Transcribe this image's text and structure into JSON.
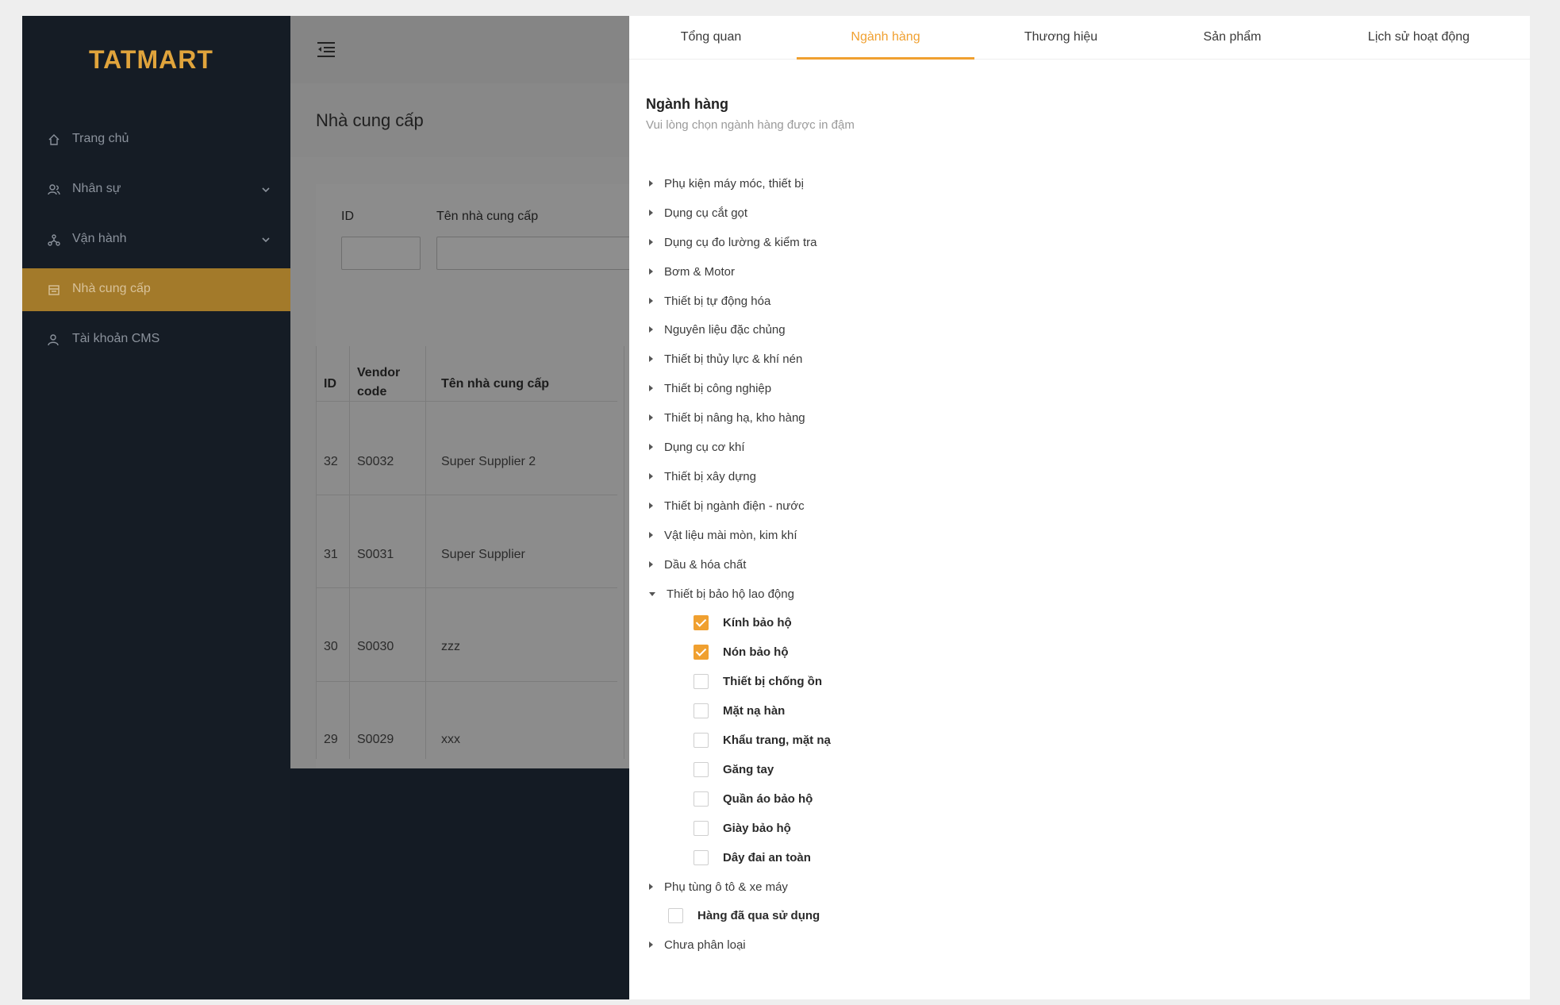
{
  "brand": {
    "logo_text": "TATMART",
    "accent": "#f0a030",
    "sidebar_bg": "#151c25"
  },
  "sidebar": {
    "items": [
      {
        "label": "Trang chủ",
        "icon": "home-icon",
        "expandable": false,
        "active": false
      },
      {
        "label": "Nhân sự",
        "icon": "users-icon",
        "expandable": true,
        "active": false
      },
      {
        "label": "Vận hành",
        "icon": "network-icon",
        "expandable": true,
        "active": false
      },
      {
        "label": "Nhà cung cấp",
        "icon": "calendar-icon",
        "expandable": false,
        "active": true
      },
      {
        "label": "Tài khoản CMS",
        "icon": "user-icon",
        "expandable": false,
        "active": false
      }
    ]
  },
  "main": {
    "title": "Nhà cung cấp",
    "filters": {
      "id_label": "ID",
      "name_label": "Tên nhà cung cấp"
    },
    "table": {
      "headers": [
        "ID",
        "Vendor code",
        "Tên nhà cung cấp"
      ],
      "rows": [
        [
          "32",
          "S0032",
          "Super Supplier 2"
        ],
        [
          "31",
          "S0031",
          "Super Supplier"
        ],
        [
          "30",
          "S0030",
          "zzz"
        ],
        [
          "29",
          "S0029",
          "xxx"
        ]
      ]
    }
  },
  "drawer": {
    "tabs": [
      "Tổng quan",
      "Ngành hàng",
      "Thương hiệu",
      "Sản phẩm",
      "Lịch sử hoạt động"
    ],
    "active_tab": "Ngành hàng",
    "section_title": "Ngành hàng",
    "section_subtitle": "Vui lòng chọn ngành hàng được in đậm",
    "categories": [
      "Phụ kiện máy móc, thiết bị",
      "Dụng cụ cắt gọt",
      "Dụng cụ đo lường & kiểm tra",
      "Bơm & Motor",
      "Thiết bị tự động hóa",
      "Nguyên liệu đặc chủng",
      "Thiết bị thủy lực & khí nén",
      "Thiết bị công nghiệp",
      "Thiết bị nâng hạ, kho hàng",
      "Dụng cụ cơ khí",
      "Thiết bị xây dựng",
      "Thiết bị ngành điện - nước",
      "Vật liệu mài mòn, kim khí",
      "Dầu & hóa chất"
    ],
    "expanded_category": "Thiết bị bảo hộ lao động",
    "subcategories": [
      {
        "label": "Kính bảo hộ",
        "checked": true
      },
      {
        "label": "Nón bảo hộ",
        "checked": true
      },
      {
        "label": "Thiết bị chống ồn",
        "checked": false
      },
      {
        "label": "Mặt nạ hàn",
        "checked": false
      },
      {
        "label": "Khẩu trang, mặt nạ",
        "checked": false
      },
      {
        "label": "Găng tay",
        "checked": false
      },
      {
        "label": "Quần áo bảo hộ",
        "checked": false
      },
      {
        "label": "Giày bảo hộ",
        "checked": false
      },
      {
        "label": "Dây đai an toàn",
        "checked": false
      }
    ],
    "after_categories": [
      {
        "type": "category",
        "label": "Phụ tùng ô tô & xe máy"
      },
      {
        "type": "leaf",
        "label": "Hàng đã qua sử dụng",
        "checked": false
      },
      {
        "type": "category",
        "label": "Chưa phân loại"
      }
    ]
  }
}
